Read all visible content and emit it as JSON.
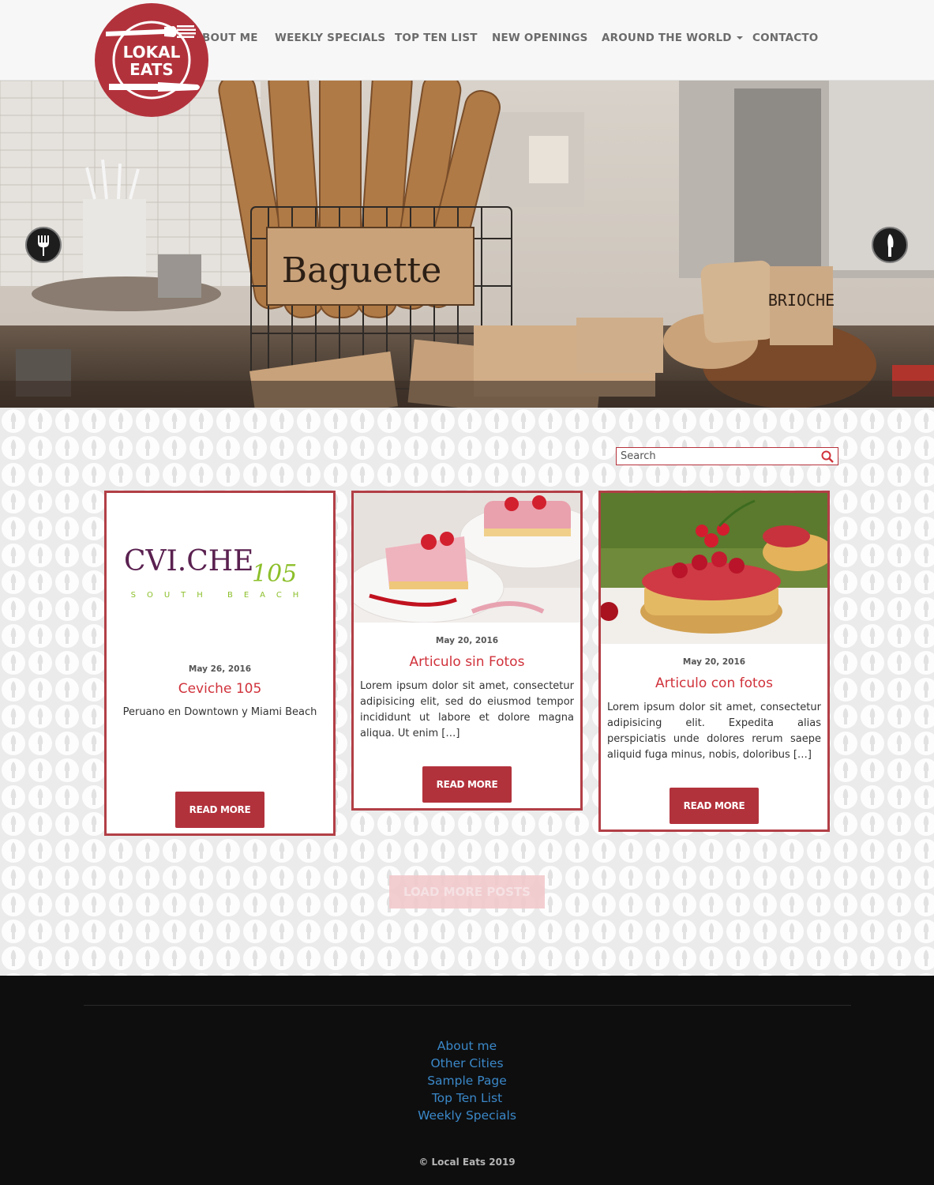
{
  "brand": {
    "logo_line1": "LOKAL",
    "logo_line2": "EATS",
    "color": "#b2323c"
  },
  "nav": {
    "items": [
      {
        "label": "BOUT ME"
      },
      {
        "label": "WEEKLY SPECIALS"
      },
      {
        "label": "TOP TEN LIST"
      },
      {
        "label": "NEW OPENINGS"
      },
      {
        "label": "AROUND THE WORLD",
        "has_dropdown": true
      },
      {
        "label": "CONTACTO"
      }
    ]
  },
  "hero": {
    "sign_baguette": "Baguette",
    "sign_brioche": "BRIOCHE",
    "prev_icon": "fork-icon",
    "next_icon": "knife-icon"
  },
  "search": {
    "placeholder": "Search"
  },
  "posts": [
    {
      "date": "May 26, 2016",
      "title": "Ceviche 105",
      "excerpt": "Peruano en Downtown y Miami Beach",
      "logo_main": "CVI.CHE",
      "logo_num": "105",
      "logo_sub": "SOUTH BEACH",
      "button": "READ MORE"
    },
    {
      "date": "May 20, 2016",
      "title": "Articulo sin Fotos",
      "excerpt": "Lorem ipsum dolor sit amet, consectetur adipisicing elit, sed do eiusmod tempor incididunt ut labore et dolore magna aliqua. Ut enim […]",
      "button": "READ MORE"
    },
    {
      "date": "May 20, 2016",
      "title": "Articulo con fotos",
      "excerpt": "Lorem ipsum dolor sit amet, consectetur adipisicing elit. Expedita alias perspiciatis unde dolores rerum saepe aliquid fuga minus, nobis, doloribus […]",
      "button": "READ MORE"
    }
  ],
  "load_more": "LOAD MORE POSTS",
  "footer": {
    "links": [
      {
        "label": "About me"
      },
      {
        "label": "Other Cities"
      },
      {
        "label": "Sample Page"
      },
      {
        "label": "Top Ten List"
      },
      {
        "label": "Weekly Specials"
      }
    ],
    "copyright": "© Local Eats 2019"
  }
}
